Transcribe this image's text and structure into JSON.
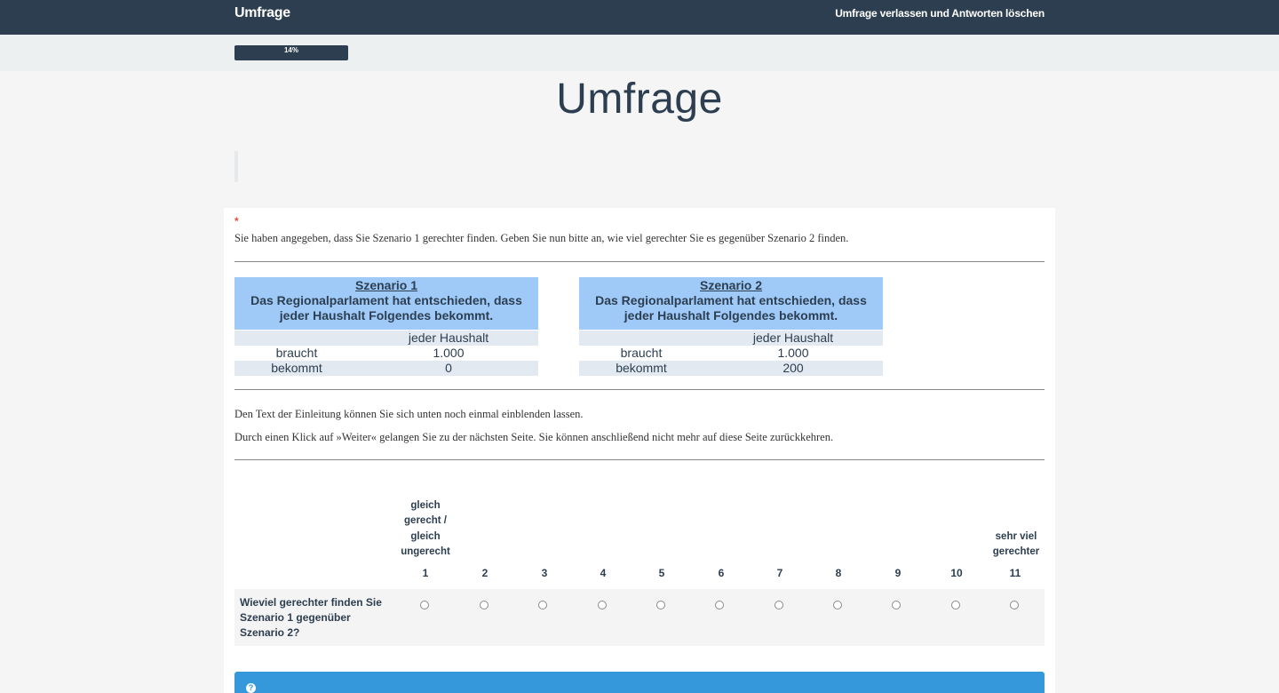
{
  "navbar": {
    "brand": "Umfrage",
    "exit_label": "Umfrage verlassen und Antworten löschen"
  },
  "progress": {
    "label": "14%",
    "value": 14
  },
  "page_title": "Umfrage",
  "question": {
    "required_marker": "*",
    "intro": "Sie haben angegeben, dass Sie Szenario 1 gerechter finden. Geben Sie nun bitte an, wie viel gerechter Sie es gegenüber Szenario 2 finden.",
    "scenarios": [
      {
        "title": "Szenario 1",
        "line1": "Das Regionalparlament hat entschieden, dass",
        "line2": "jeder Haushalt Folgendes bekommt.",
        "col_header": "jeder Haushalt",
        "rows": [
          {
            "label": "braucht",
            "value": "1.000"
          },
          {
            "label": "bekommt",
            "value": "0"
          }
        ]
      },
      {
        "title": "Szenario 2",
        "line1": "Das Regionalparlament hat entschieden, dass",
        "line2": "jeder Haushalt Folgendes bekommt.",
        "col_header": "jeder Haushalt",
        "rows": [
          {
            "label": "braucht",
            "value": "1.000"
          },
          {
            "label": "bekommt",
            "value": "200"
          }
        ]
      }
    ],
    "text1": "Den Text der Einleitung können Sie sich unten noch einmal einblenden lassen.",
    "text2": "Durch einen Klick auf »Weiter« gelangen Sie zu der nächsten Seite. Sie können anschließend nicht mehr auf diese Seite zurückkehren.",
    "scale": {
      "left_anchor": [
        "gleich",
        "gerecht /",
        "gleich",
        "ungerecht"
      ],
      "right_anchor": [
        "sehr viel",
        "gerechter"
      ],
      "numbers": [
        "1",
        "2",
        "3",
        "4",
        "5",
        "6",
        "7",
        "8",
        "9",
        "10",
        "11"
      ],
      "row_label": "Wieviel gerechter finden Sie Szenario 1 gegenüber Szenario 2?"
    }
  },
  "help": {
    "icon": "question-circle-icon"
  },
  "colors": {
    "navbar": "#2c3e50",
    "scenario_header": "#9fcaf8",
    "help_bar": "#3498db",
    "required": "#e74c3c"
  }
}
